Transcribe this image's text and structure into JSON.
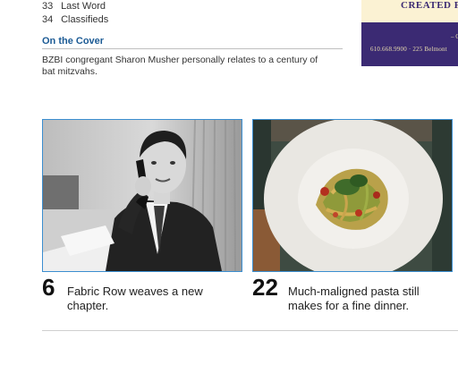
{
  "toc": [
    {
      "number": "33",
      "title": "Last Word"
    },
    {
      "number": "34",
      "title": "Classifieds"
    }
  ],
  "cover": {
    "heading": "On the Cover",
    "description": "BZBI congregant Sharon Musher personally relates to a century of bat mitzvahs."
  },
  "ad": {
    "headline": "CREATED F",
    "dash": "– C",
    "contact": "610.668.9900 · 225 Belmont"
  },
  "features": [
    {
      "number": "6",
      "text": "Fabric Row weaves a new chapter."
    },
    {
      "number": "22",
      "text": "Much-maligned pasta still makes for a fine dinner."
    }
  ],
  "colors": {
    "heading": "#1c5b95",
    "photo_border": "#3b8ed0",
    "ad_background": "#3b2a73",
    "ad_text": "#e8dcae"
  }
}
